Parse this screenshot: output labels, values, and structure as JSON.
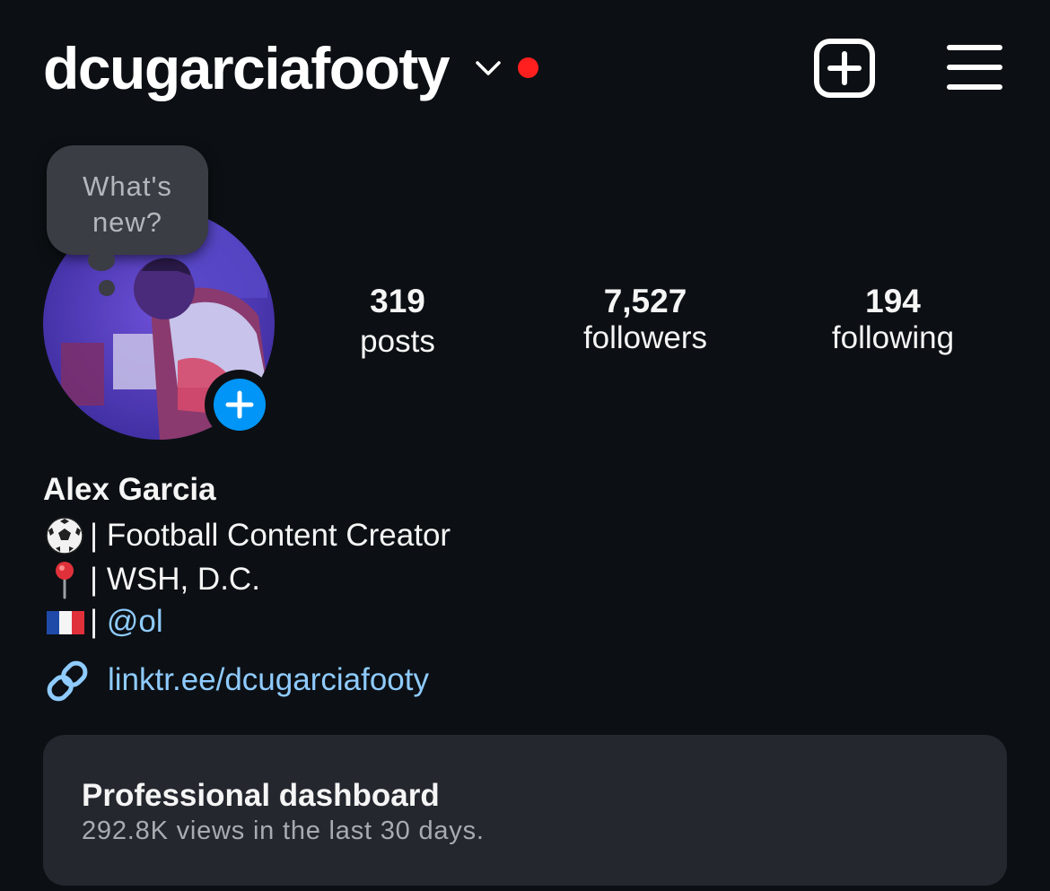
{
  "header": {
    "username": "dcugarciafooty",
    "account_switch_icon": "chevron-down-icon",
    "notification_dot_color": "#ff1f1f",
    "new_post_icon": "plus-square-icon",
    "menu_icon": "hamburger-menu-icon"
  },
  "profile": {
    "avatar_alt": "profile photo",
    "add_story_icon": "plus-icon",
    "note_bubble": "What's new?"
  },
  "stats": [
    {
      "value": "319",
      "label": "posts"
    },
    {
      "value": "7,527",
      "label": "followers"
    },
    {
      "value": "194",
      "label": "following"
    }
  ],
  "bio": {
    "display_name": "Alex Garcia",
    "lines": [
      {
        "icon": "soccer-ball-icon",
        "text": "| Football Content Creator"
      },
      {
        "icon": "pin-icon",
        "text": "| WSH, D.C."
      },
      {
        "icon": "france-flag-icon",
        "prefix": "| ",
        "mention": "@ol"
      }
    ],
    "link_icon": "link-icon",
    "link": "linktr.ee/dcugarciafooty"
  },
  "dashboard": {
    "title": "Professional dashboard",
    "subtitle": "292.8K views in the last 30 days."
  },
  "colors": {
    "background": "#0c1014",
    "accent_blue": "#0095f6",
    "link_blue": "#8fcbff",
    "card": "#24272e"
  }
}
